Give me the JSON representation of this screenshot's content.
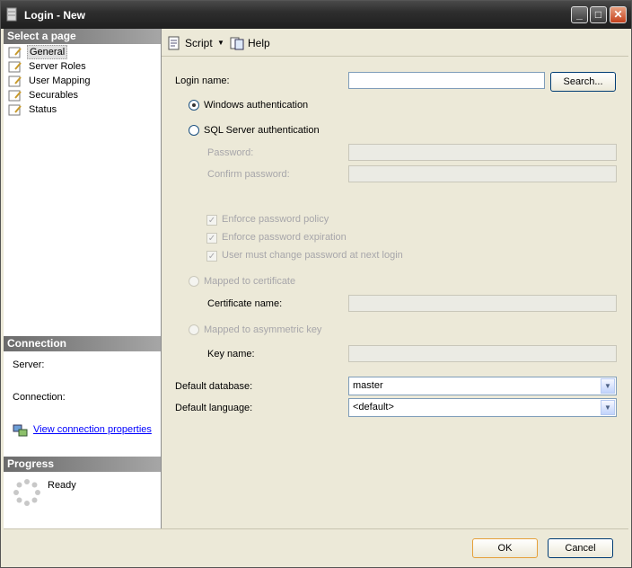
{
  "window": {
    "title": "Login - New"
  },
  "left_pane": {
    "select_page_header": "Select a page",
    "pages": [
      {
        "label": "General",
        "selected": true
      },
      {
        "label": "Server Roles",
        "selected": false
      },
      {
        "label": "User Mapping",
        "selected": false
      },
      {
        "label": "Securables",
        "selected": false
      },
      {
        "label": "Status",
        "selected": false
      }
    ],
    "connection_header": "Connection",
    "server_label": "Server:",
    "connection_label": "Connection:",
    "view_connection_properties": "View connection properties",
    "progress_header": "Progress",
    "progress_status": "Ready"
  },
  "toolbar": {
    "script_label": "Script",
    "help_label": "Help"
  },
  "general": {
    "login_name_label": "Login name:",
    "login_name_value": "",
    "search_button": "Search...",
    "windows_auth_label": "Windows authentication",
    "windows_auth_selected": true,
    "sql_auth_label": "SQL Server authentication",
    "sql_auth_selected": false,
    "password_label": "Password:",
    "confirm_password_label": "Confirm password:",
    "enforce_policy_label": "Enforce password policy",
    "enforce_expiration_label": "Enforce password expiration",
    "must_change_label": "User must change password at next login",
    "mapped_cert_label": "Mapped to certificate",
    "certificate_name_label": "Certificate name:",
    "mapped_asym_label": "Mapped to asymmetric key",
    "key_name_label": "Key name:",
    "default_database_label": "Default database:",
    "default_database_value": "master",
    "default_language_label": "Default language:",
    "default_language_value": "<default>"
  },
  "footer": {
    "ok_button": "OK",
    "cancel_button": "Cancel"
  },
  "colors": {
    "selected_page_bg": "#e0e0e0",
    "link": "#0000ff",
    "disabled_text": "#a7a6aa"
  }
}
